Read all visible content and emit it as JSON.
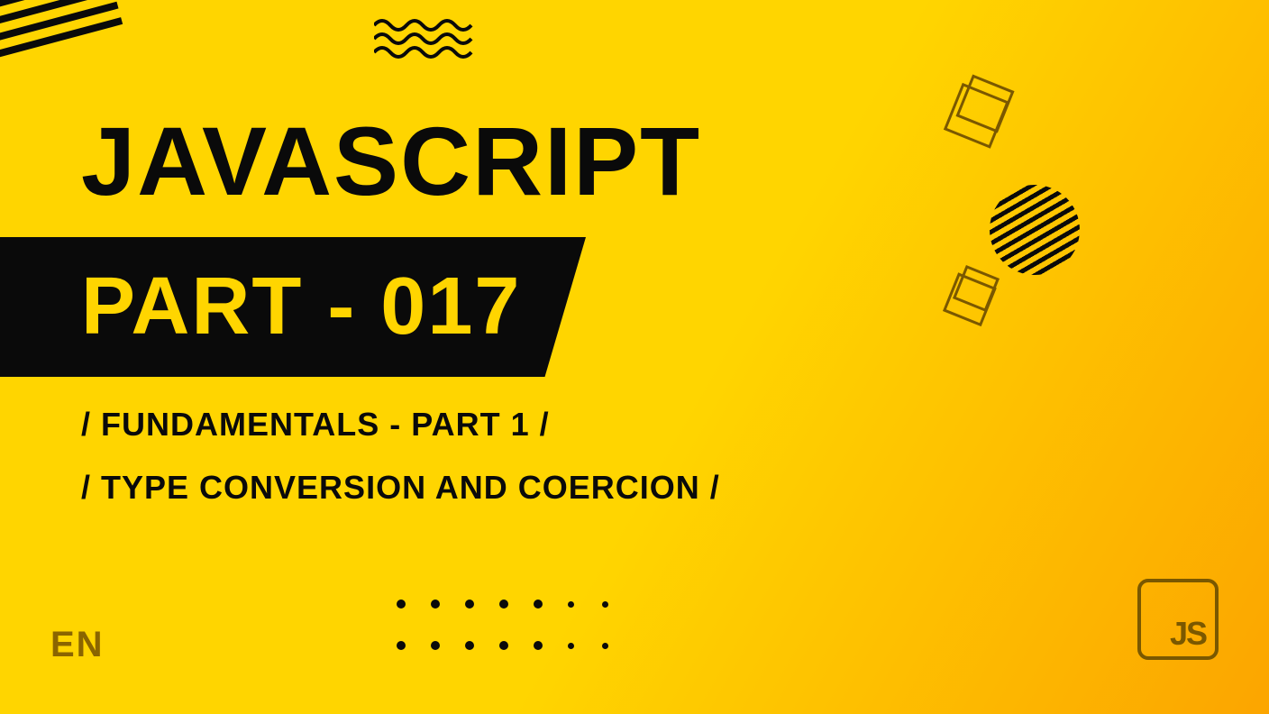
{
  "title": "JAVASCRIPT",
  "part_label": "PART - 017",
  "subtitle_1": "/ FUNDAMENTALS - PART 1 /",
  "subtitle_2": "/ TYPE CONVERSION AND COERCION /",
  "language": "EN",
  "logo_text": "JS",
  "colors": {
    "yellow": "#FFD500",
    "orange": "#FCA500",
    "dark": "#0a0a0a",
    "accent": "#7a5800"
  }
}
